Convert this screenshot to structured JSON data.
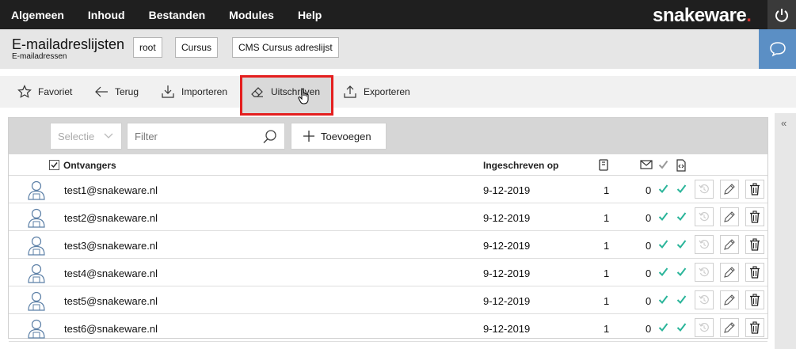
{
  "topnav": [
    "Algemeen",
    "Inhoud",
    "Bestanden",
    "Modules",
    "Help"
  ],
  "brand": {
    "name": "snakeware",
    "dot": "."
  },
  "header": {
    "title": "E-mailadreslijsten",
    "subtitle": "E-mailadressen",
    "breadcrumbs": [
      "root",
      "Cursus",
      "CMS Cursus adreslijst"
    ]
  },
  "toolbar": {
    "favoriet": "Favoriet",
    "terug": "Terug",
    "importeren": "Importeren",
    "uitschrijven": "Uitschrijven",
    "exporteren": "Exporteren"
  },
  "filterbar": {
    "select_placeholder": "Selectie",
    "filter_placeholder": "Filter",
    "add_label": "Toevoegen"
  },
  "table": {
    "columns": {
      "recipients": "Ontvangers",
      "subscribed_on": "Ingeschreven op"
    },
    "rows": [
      {
        "email": "test1@snakeware.nl",
        "date": "9-12-2019",
        "count1": "1",
        "count2": "0"
      },
      {
        "email": "test2@snakeware.nl",
        "date": "9-12-2019",
        "count1": "1",
        "count2": "0"
      },
      {
        "email": "test3@snakeware.nl",
        "date": "9-12-2019",
        "count1": "1",
        "count2": "0"
      },
      {
        "email": "test4@snakeware.nl",
        "date": "9-12-2019",
        "count1": "1",
        "count2": "0"
      },
      {
        "email": "test5@snakeware.nl",
        "date": "9-12-2019",
        "count1": "1",
        "count2": "0"
      },
      {
        "email": "test6@snakeware.nl",
        "date": "9-12-2019",
        "count1": "1",
        "count2": "0"
      }
    ]
  },
  "colors": {
    "topbar": "#1f1f1f",
    "accent_blue": "#5b8fc5",
    "check_green": "#2bb59a",
    "highlight_red": "#e41e1e",
    "brand_red": "#d1332e"
  }
}
